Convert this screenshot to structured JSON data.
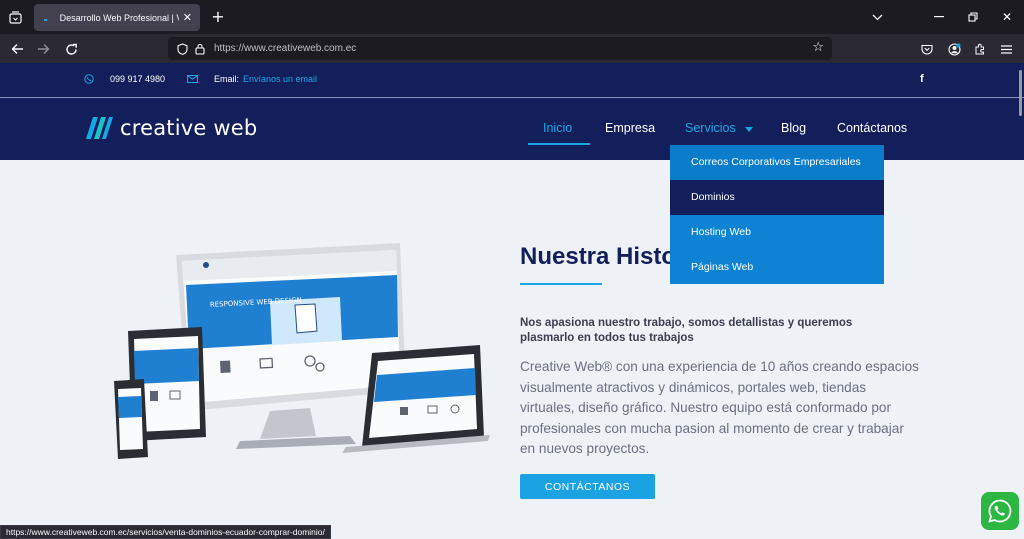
{
  "browser": {
    "tab_title": "Desarrollo Web Profesional | Ve",
    "url": "https://www.creativeweb.com.ec",
    "status_url": "https://www.creativeweb.com.ec/servicios/venta-dominios-ecuador-comprar-dominio/"
  },
  "topbar": {
    "phone": "099 917 4980",
    "email_label": "Email:",
    "email_link": "Envíanos un email",
    "social": "f"
  },
  "header": {
    "logo_text": "creative web",
    "menu": {
      "inicio": "Inicio",
      "empresa": "Empresa",
      "servicios": "Servicios",
      "blog": "Blog",
      "contactanos": "Contáctanos"
    }
  },
  "dropdown": {
    "items": [
      "Correos Corporativos Empresariales",
      "Dominios",
      "Hosting Web",
      "Páginas Web"
    ]
  },
  "hero": {
    "title": "Nuestra Historia",
    "subtitle": "Nos apasiona nuestro trabajo, somos detallistas y queremos plasmarlo en todos tus trabajos",
    "body": "Creative Web® con una experiencia de 10 años creando espacios visualmente atractivos y dinámicos, portales web, tiendas virtuales, diseño gráfico. Nuestro equipo está conformado por profesionales con mucha pasion al momento de crear y trabajar en nuevos proyectos.",
    "cta": "CONTÁCTANOS",
    "device_banner": "RESPONSIVE WEB DESIGN"
  },
  "colors": {
    "navy": "#121f5a",
    "accent": "#18a6e5",
    "dropdown": "#0e83d3"
  }
}
